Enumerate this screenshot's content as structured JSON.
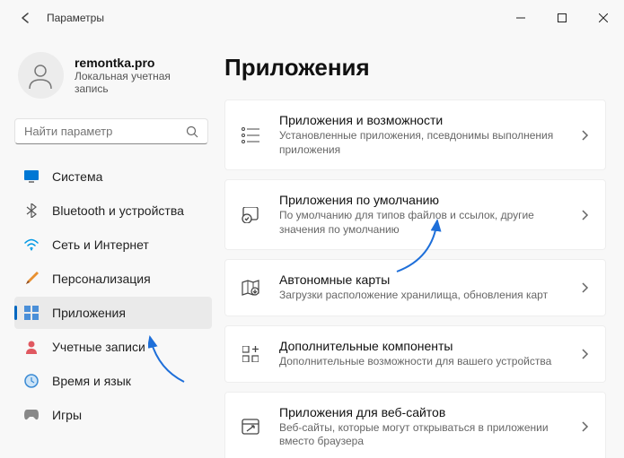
{
  "window": {
    "title": "Параметры"
  },
  "user": {
    "name": "remontka.pro",
    "sub": "Локальная учетная запись"
  },
  "search": {
    "placeholder": "Найти параметр"
  },
  "nav": {
    "items": [
      {
        "label": "Система"
      },
      {
        "label": "Bluetooth и устройства"
      },
      {
        "label": "Сеть и Интернет"
      },
      {
        "label": "Персонализация"
      },
      {
        "label": "Приложения"
      },
      {
        "label": "Учетные записи"
      },
      {
        "label": "Время и язык"
      },
      {
        "label": "Игры"
      }
    ]
  },
  "main": {
    "title": "Приложения",
    "cards": [
      {
        "title": "Приложения и возможности",
        "sub": "Установленные приложения, псевдонимы выполнения приложения"
      },
      {
        "title": "Приложения по умолчанию",
        "sub": "По умолчанию для типов файлов и ссылок, другие значения по умолчанию"
      },
      {
        "title": "Автономные карты",
        "sub": "Загрузки расположение хранилища, обновления карт"
      },
      {
        "title": "Дополнительные компоненты",
        "sub": "Дополнительные возможности для вашего устройства"
      },
      {
        "title": "Приложения для веб-сайтов",
        "sub": "Веб-сайты, которые могут открываться в приложении вместо браузера"
      }
    ]
  }
}
